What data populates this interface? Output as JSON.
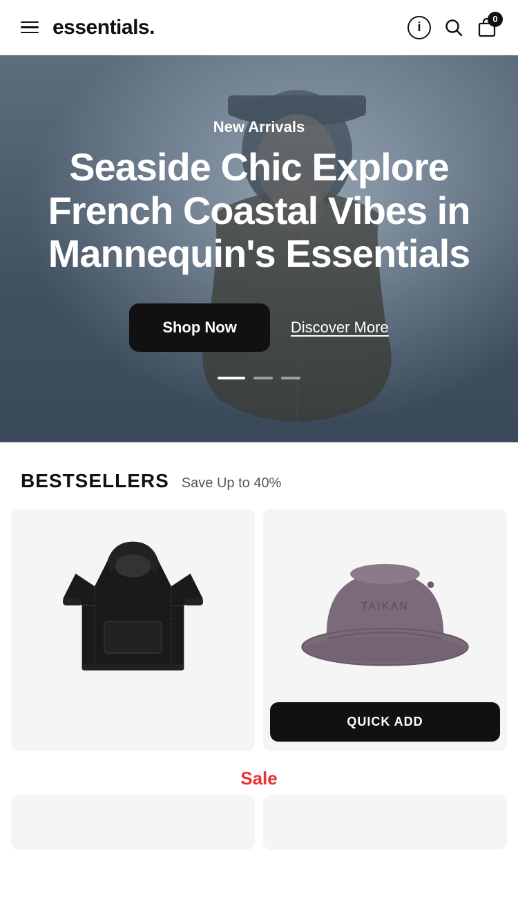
{
  "header": {
    "brand": "essentials.",
    "cart_count": "0",
    "aria_info": "i",
    "aria_search": "🔍",
    "aria_cart": "🛍"
  },
  "hero": {
    "subtitle": "New Arrivals",
    "title": "Seaside Chic Explore French Coastal Vibes in Mannequin's Essentials",
    "btn_shop": "Shop Now",
    "btn_discover": "Discover More",
    "dots": [
      {
        "active": true
      },
      {
        "active": false
      },
      {
        "active": false
      }
    ]
  },
  "bestsellers": {
    "title": "BESTSELLERS",
    "subtitle": "Save Up to 40%"
  },
  "products": [
    {
      "name": "Black Hoodie",
      "type": "hoodie",
      "quick_add": null
    },
    {
      "name": "Taikan Bucket Hat",
      "type": "hat",
      "quick_add": "QUICK ADD"
    }
  ],
  "sale": {
    "label": "Sale"
  }
}
